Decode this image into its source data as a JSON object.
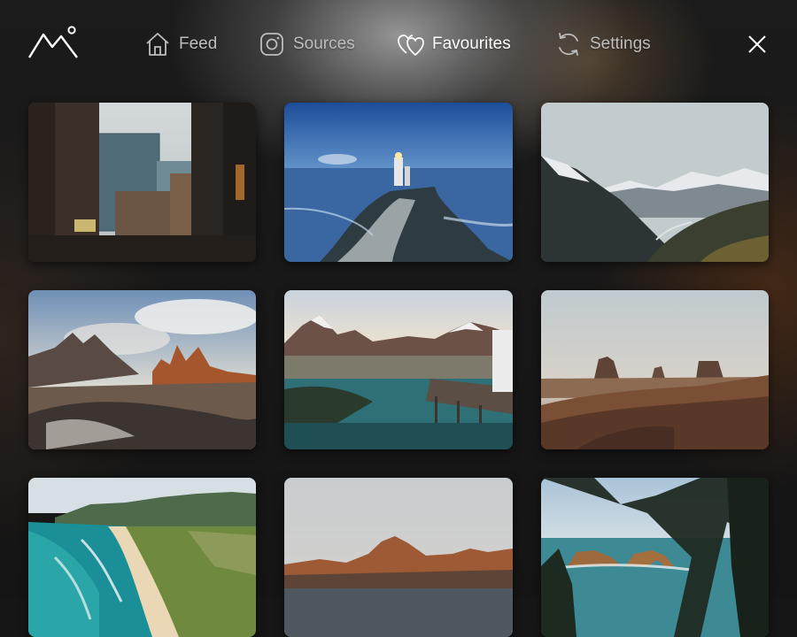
{
  "app": {
    "logo_icon": "mountain-logo-icon"
  },
  "nav": [
    {
      "id": "feed",
      "label": "Feed",
      "icon": "home-icon",
      "active": false
    },
    {
      "id": "sources",
      "label": "Sources",
      "icon": "instagram-icon",
      "active": false
    },
    {
      "id": "favourites",
      "label": "Favourites",
      "icon": "hearts-icon",
      "active": true
    },
    {
      "id": "settings",
      "label": "Settings",
      "icon": "refresh-icon",
      "active": false
    }
  ],
  "close_icon": "close-icon",
  "gallery": [
    {
      "id": "city-street"
    },
    {
      "id": "lighthouse-pier"
    },
    {
      "id": "mountain-valley"
    },
    {
      "id": "dolomite-peaks"
    },
    {
      "id": "fjord-dock"
    },
    {
      "id": "monument-valley"
    },
    {
      "id": "coastal-beach"
    },
    {
      "id": "red-mountain-lake"
    },
    {
      "id": "sea-stacks"
    }
  ],
  "colors": {
    "nav_active": "#ffffff",
    "nav_inactive": "#bdbdbd",
    "background": "#161616"
  }
}
